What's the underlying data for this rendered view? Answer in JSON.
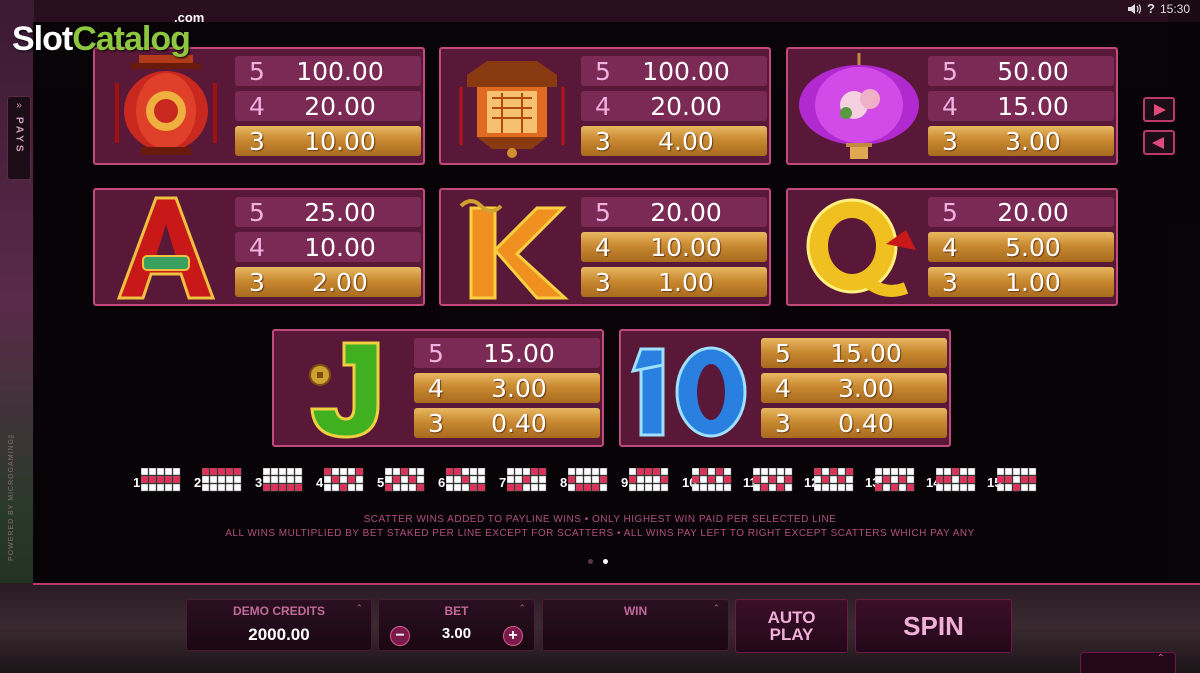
{
  "watermark": {
    "slot": "Slot",
    "catalog": "Catalog",
    "com": ".com"
  },
  "status": {
    "help": "?",
    "time": "15:30"
  },
  "side": {
    "pays_label": "PAYS",
    "arrow": "»",
    "credit": "POWERED BY MICROGAMING™"
  },
  "cards": [
    {
      "symbol": "red-lantern",
      "rows": [
        {
          "count": "5",
          "amount": "100.00",
          "style": "plain"
        },
        {
          "count": "4",
          "amount": "20.00",
          "style": "plain"
        },
        {
          "count": "3",
          "amount": "10.00",
          "style": "gold"
        }
      ]
    },
    {
      "symbol": "hexagon-lantern",
      "rows": [
        {
          "count": "5",
          "amount": "100.00",
          "style": "plain"
        },
        {
          "count": "4",
          "amount": "20.00",
          "style": "plain"
        },
        {
          "count": "3",
          "amount": "4.00",
          "style": "gold"
        }
      ]
    },
    {
      "symbol": "purple-flower-lantern",
      "rows": [
        {
          "count": "5",
          "amount": "50.00",
          "style": "plain"
        },
        {
          "count": "4",
          "amount": "15.00",
          "style": "plain"
        },
        {
          "count": "3",
          "amount": "3.00",
          "style": "gold"
        }
      ]
    },
    {
      "symbol": "letter-A",
      "rows": [
        {
          "count": "5",
          "amount": "25.00",
          "style": "plain"
        },
        {
          "count": "4",
          "amount": "10.00",
          "style": "plain"
        },
        {
          "count": "3",
          "amount": "2.00",
          "style": "gold"
        }
      ]
    },
    {
      "symbol": "letter-K",
      "rows": [
        {
          "count": "5",
          "amount": "20.00",
          "style": "plain"
        },
        {
          "count": "4",
          "amount": "10.00",
          "style": "gold"
        },
        {
          "count": "3",
          "amount": "1.00",
          "style": "gold"
        }
      ]
    },
    {
      "symbol": "letter-Q",
      "rows": [
        {
          "count": "5",
          "amount": "20.00",
          "style": "plain"
        },
        {
          "count": "4",
          "amount": "5.00",
          "style": "gold"
        },
        {
          "count": "3",
          "amount": "1.00",
          "style": "gold"
        }
      ]
    },
    {
      "symbol": "letter-J",
      "rows": [
        {
          "count": "5",
          "amount": "15.00",
          "style": "plain"
        },
        {
          "count": "4",
          "amount": "3.00",
          "style": "gold"
        },
        {
          "count": "3",
          "amount": "0.40",
          "style": "gold"
        }
      ]
    },
    {
      "symbol": "number-10",
      "rows": [
        {
          "count": "5",
          "amount": "15.00",
          "style": "gold"
        },
        {
          "count": "4",
          "amount": "3.00",
          "style": "gold"
        },
        {
          "count": "3",
          "amount": "0.40",
          "style": "gold"
        }
      ]
    }
  ],
  "paylines": [
    "1",
    "2",
    "3",
    "4",
    "5",
    "6",
    "7",
    "8",
    "9",
    "10",
    "11",
    "12",
    "13",
    "14",
    "15"
  ],
  "rules": {
    "line1": "SCATTER WINS ADDED TO PAYLINE WINS  •  ONLY HIGHEST WIN PAID PER SELECTED LINE",
    "line2": "ALL WINS MULTIPLIED BY BET STAKED PER LINE EXCEPT FOR SCATTERS  •  ALL WINS PAY LEFT TO RIGHT EXCEPT SCATTERS WHICH PAY ANY"
  },
  "pagination": {
    "pages": 2,
    "current": 2
  },
  "controls": {
    "credits_label": "DEMO CREDITS",
    "credits_value": "2000.00",
    "bet_label": "BET",
    "bet_value": "3.00",
    "bet_minus": "−",
    "bet_plus": "+",
    "win_label": "WIN",
    "win_value": "",
    "caret": "⌃",
    "autoplay_line1": "AUTO",
    "autoplay_line2": "PLAY",
    "spin": "SPIN"
  },
  "colors": {
    "accent": "#c04a7a",
    "gold": "#d9a04a",
    "card_bg": "#5a1838"
  }
}
